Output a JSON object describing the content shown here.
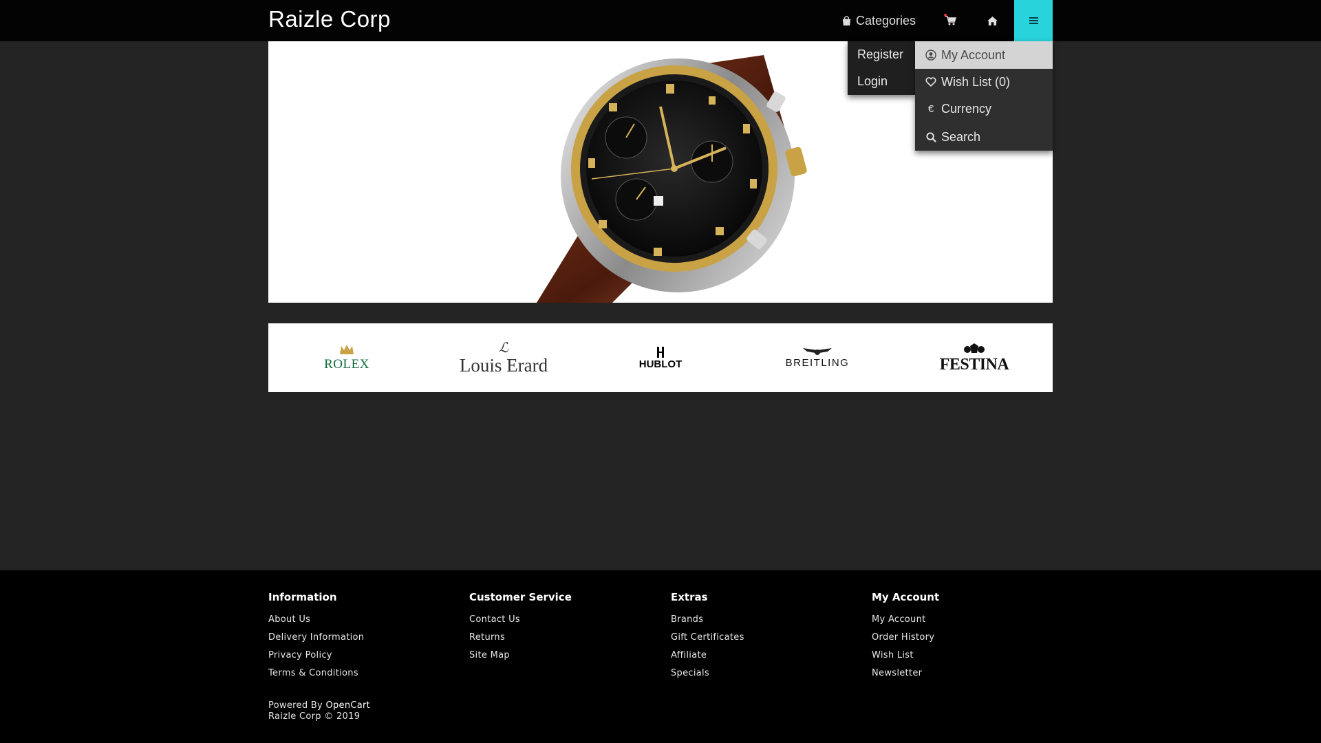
{
  "header": {
    "brand": "Raizle Corp",
    "categories_label": "Categories",
    "cart_icon": "cart-icon",
    "home_icon": "home-icon",
    "menu_icon": "menu-icon",
    "accent_color": "#29d3dc"
  },
  "account_dropdown": {
    "items": [
      "Register",
      "Login"
    ]
  },
  "main_menu": {
    "items": [
      {
        "label": "My Account",
        "icon": "user-circle-icon",
        "active": true
      },
      {
        "label": "Wish List (0)",
        "icon": "heart-icon",
        "active": false
      },
      {
        "label": "Currency",
        "icon": "euro-icon",
        "glyph": "€",
        "active": false
      },
      {
        "label": "Search",
        "icon": "search-icon",
        "active": false
      }
    ]
  },
  "hero": {
    "subject": "Chronograph watch with gold bezel and brown leather strap"
  },
  "brands": [
    {
      "name": "ROLEX",
      "color": "#0e6b3a"
    },
    {
      "name": "Louis Erard",
      "color": "#333333"
    },
    {
      "name": "HUBLOT",
      "color": "#000000"
    },
    {
      "name": "BREITLING",
      "color": "#111111"
    },
    {
      "name": "FESTINA",
      "color": "#111111"
    }
  ],
  "footer": {
    "columns": [
      {
        "title": "Information",
        "links": [
          "About Us",
          "Delivery Information",
          "Privacy Policy",
          "Terms & Conditions"
        ]
      },
      {
        "title": "Customer Service",
        "links": [
          "Contact Us",
          "Returns",
          "Site Map"
        ]
      },
      {
        "title": "Extras",
        "links": [
          "Brands",
          "Gift Certificates",
          "Affiliate",
          "Specials"
        ]
      },
      {
        "title": "My Account",
        "links": [
          "My Account",
          "Order History",
          "Wish List",
          "Newsletter"
        ]
      }
    ],
    "powered_by_prefix": "Powered By",
    "powered_by_link": "OpenCart",
    "copyright": "Raizle Corp © 2019"
  }
}
